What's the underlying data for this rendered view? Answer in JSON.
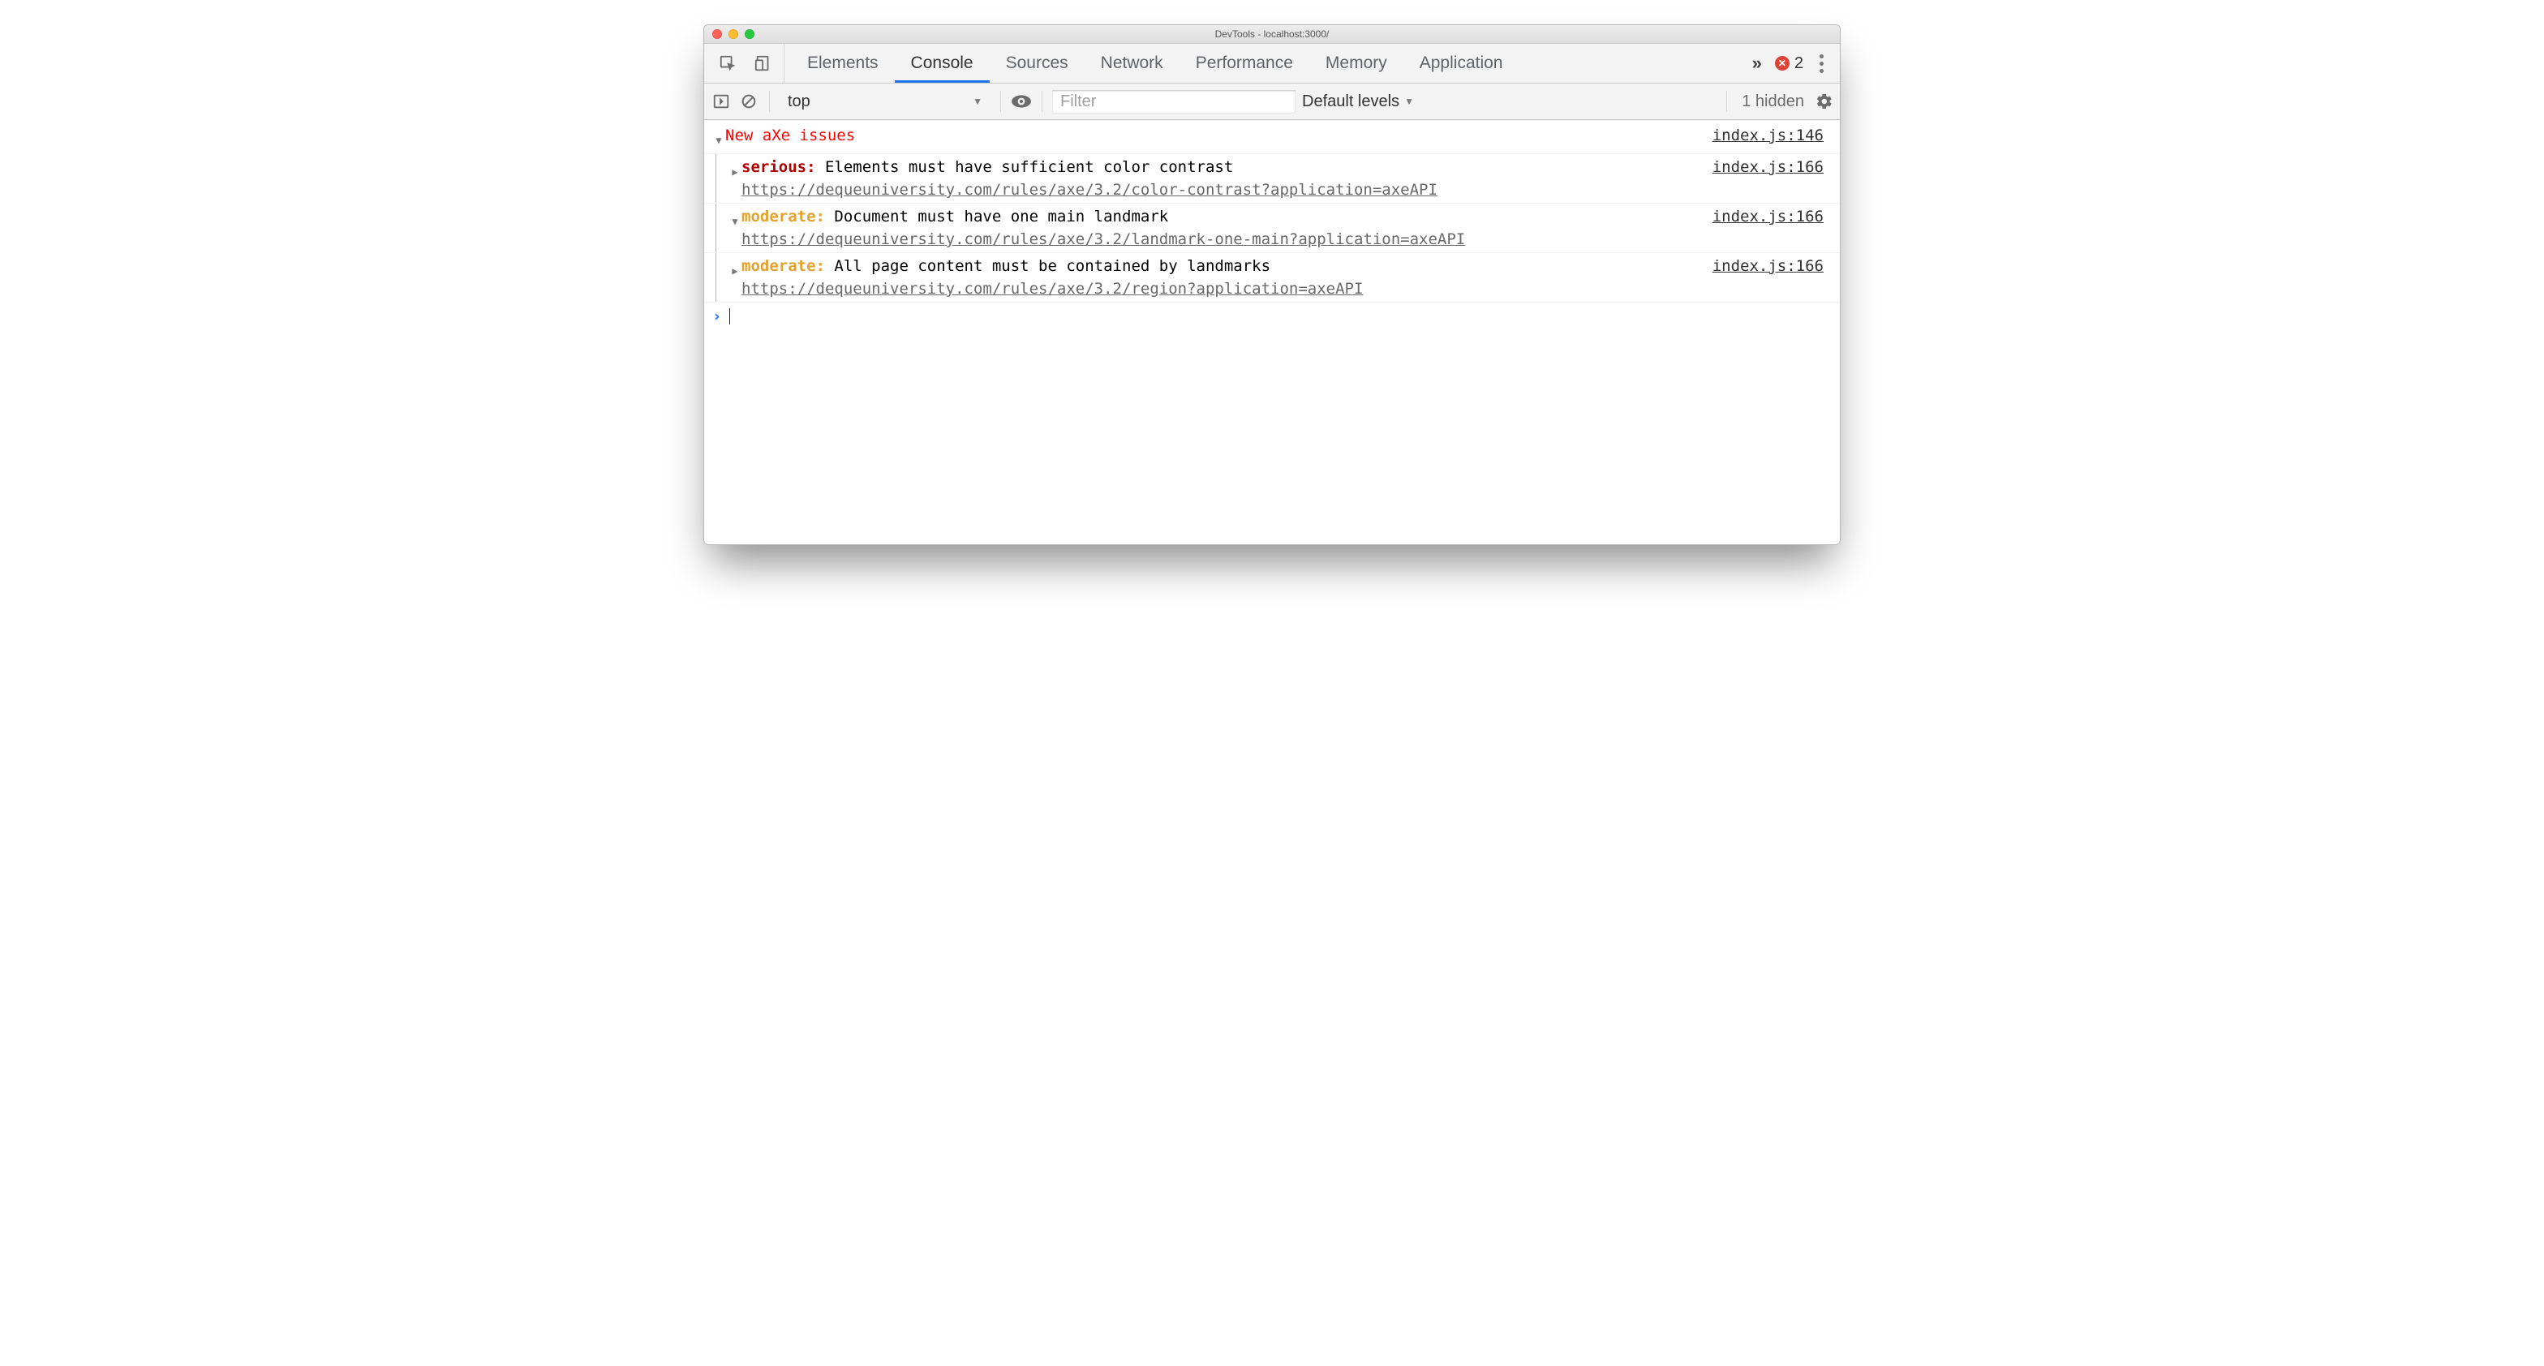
{
  "window": {
    "title": "DevTools - localhost:3000/"
  },
  "tabs": {
    "items": [
      "Elements",
      "Console",
      "Sources",
      "Network",
      "Performance",
      "Memory",
      "Application"
    ],
    "active_index": 1,
    "overflow_glyph": "»",
    "error_count": "2"
  },
  "subbar": {
    "context": "top",
    "filter_placeholder": "Filter",
    "levels_label": "Default levels",
    "hidden_label": "1 hidden"
  },
  "console": {
    "group": {
      "label": "New aXe issues",
      "source": "index.js:146"
    },
    "entries": [
      {
        "expanded": false,
        "severity_key": "serious",
        "severity_label": "serious:",
        "message": "Elements must have sufficient color contrast",
        "url": "https://dequeuniversity.com/rules/axe/3.2/color-contrast?application=axeAPI",
        "source": "index.js:166"
      },
      {
        "expanded": true,
        "severity_key": "moderate",
        "severity_label": "moderate:",
        "message": "Document must have one main landmark",
        "url": "https://dequeuniversity.com/rules/axe/3.2/landmark-one-main?application=axeAPI",
        "source": "index.js:166"
      },
      {
        "expanded": false,
        "severity_key": "moderate",
        "severity_label": "moderate:",
        "message": "All page content must be contained by landmarks",
        "url": "https://dequeuniversity.com/rules/axe/3.2/region?application=axeAPI",
        "source": "index.js:166"
      }
    ]
  }
}
